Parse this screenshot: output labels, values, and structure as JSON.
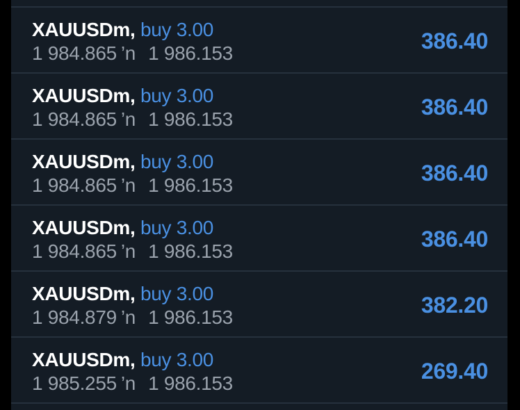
{
  "positions": [
    {
      "symbol": "XAUUSDm",
      "separator": ",",
      "side": "buy 3.00",
      "open_price": "1 984.865",
      "arrow": "’n",
      "current_price": "1 986.153",
      "profit": "386.40"
    },
    {
      "symbol": "XAUUSDm",
      "separator": ",",
      "side": "buy 3.00",
      "open_price": "1 984.865",
      "arrow": "’n",
      "current_price": "1 986.153",
      "profit": "386.40"
    },
    {
      "symbol": "XAUUSDm",
      "separator": ",",
      "side": "buy 3.00",
      "open_price": "1 984.865",
      "arrow": "’n",
      "current_price": "1 986.153",
      "profit": "386.40"
    },
    {
      "symbol": "XAUUSDm",
      "separator": ",",
      "side": "buy 3.00",
      "open_price": "1 984.865",
      "arrow": "’n",
      "current_price": "1 986.153",
      "profit": "386.40"
    },
    {
      "symbol": "XAUUSDm",
      "separator": ",",
      "side": "buy 3.00",
      "open_price": "1 984.879",
      "arrow": "’n",
      "current_price": "1 986.153",
      "profit": "382.20"
    },
    {
      "symbol": "XAUUSDm",
      "separator": ",",
      "side": "buy 3.00",
      "open_price": "1 985.255",
      "arrow": "’n",
      "current_price": "1 986.153",
      "profit": "269.40"
    }
  ],
  "colors": {
    "background": "#141c25",
    "buy": "#4a90e2",
    "profit": "#4a90e2",
    "symbol": "#ffffff",
    "prices": "#9aa2ac"
  }
}
